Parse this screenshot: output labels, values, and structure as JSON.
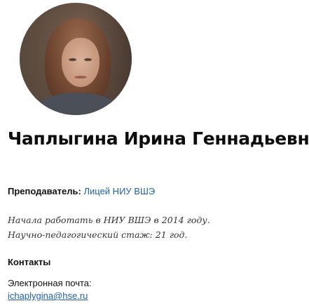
{
  "person": {
    "name": "Чаплыгина Ирина Геннадьевна",
    "role_label": "Преподаватель:",
    "role_link": "Лицей НИУ ВШЭ",
    "bio_line1": "Начала работать в НИУ ВШЭ в 2014 году.",
    "bio_line2": "Научно-педагогический стаж: 21 год."
  },
  "contacts": {
    "heading": "Контакты",
    "email_label": "Электронная почта:",
    "email": "ichaplygina@hse.ru"
  },
  "colors": {
    "link": "#1f5fb2",
    "text": "#111111"
  }
}
